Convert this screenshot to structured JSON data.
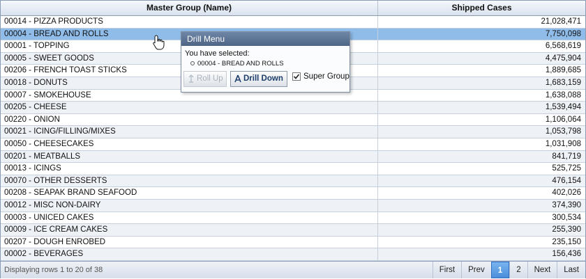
{
  "grid": {
    "columns": {
      "name": "Master Group (Name)",
      "cases": "Shipped Cases"
    },
    "rows": [
      {
        "name": "00014 - PIZZA PRODUCTS",
        "cases": "21,028,471"
      },
      {
        "name": "00004 - BREAD AND ROLLS",
        "cases": "7,750,098"
      },
      {
        "name": "00001 - TOPPING",
        "cases": "6,568,619"
      },
      {
        "name": "00005 - SWEET GOODS",
        "cases": "4,475,904"
      },
      {
        "name": "00206 - FRENCH TOAST STICKS",
        "cases": "1,889,685"
      },
      {
        "name": "00018 - DONUTS",
        "cases": "1,683,159"
      },
      {
        "name": "00007 - SMOKEHOUSE",
        "cases": "1,638,088"
      },
      {
        "name": "00205 - CHEESE",
        "cases": "1,539,494"
      },
      {
        "name": "00220 - ONION",
        "cases": "1,106,064"
      },
      {
        "name": "00021 - ICING/FILLING/MIXES",
        "cases": "1,053,798"
      },
      {
        "name": "00050 - CHEESECAKES",
        "cases": "1,031,908"
      },
      {
        "name": "00201 - MEATBALLS",
        "cases": "841,719"
      },
      {
        "name": "00013 - ICINGS",
        "cases": "525,725"
      },
      {
        "name": "00070 - OTHER DESSERTS",
        "cases": "476,154"
      },
      {
        "name": "00208 - SEAPAK BRAND SEAFOOD",
        "cases": "402,026"
      },
      {
        "name": "00012 - MISC NON-DAIRY",
        "cases": "374,390"
      },
      {
        "name": "00003 - UNICED CAKES",
        "cases": "300,534"
      },
      {
        "name": "00009 - ICE CREAM CAKES",
        "cases": "255,390"
      },
      {
        "name": "00207 - DOUGH ENROBED",
        "cases": "235,150"
      },
      {
        "name": "00002 - BEVERAGES",
        "cases": "156,436"
      }
    ],
    "selected_index": 1
  },
  "footer": {
    "status": "Displaying rows 1 to 20 of 38",
    "pager": {
      "first": "First",
      "prev": "Prev",
      "page1": "1",
      "page2": "2",
      "next": "Next",
      "last": "Last"
    },
    "active_page": "1"
  },
  "drill_menu": {
    "title": "Drill Menu",
    "selected_label": "You have selected:",
    "selected_item": "00004 - BREAD AND ROLLS",
    "roll_up_label": "Roll Up",
    "drill_down_label": "Drill Down",
    "super_group_label": "Super Group",
    "super_group_checked": true
  },
  "colors": {
    "selected_row": "#8fbce9",
    "active_page": "#4a8fdb",
    "popup_title": "#4e6586"
  }
}
